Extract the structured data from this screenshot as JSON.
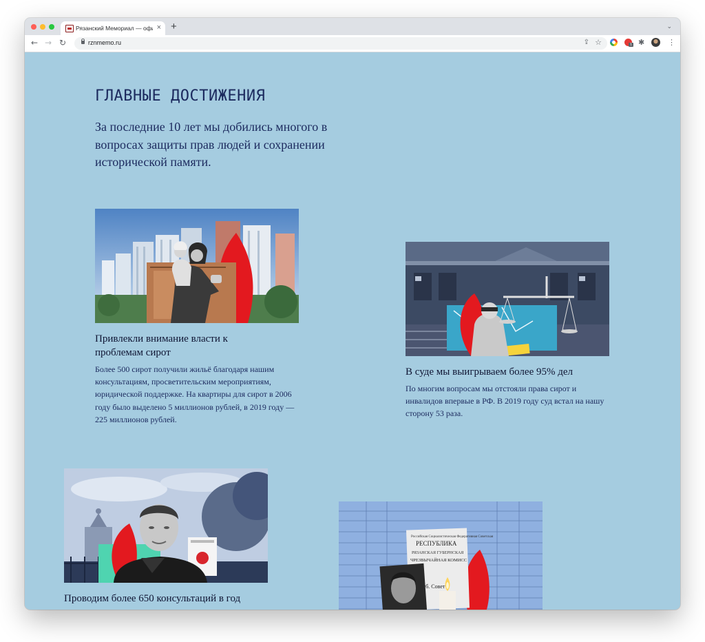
{
  "browser": {
    "tab_title": "Рязанский Мемориал — официальный сайт",
    "tab_close": "×",
    "new_tab": "+",
    "tab_menu": "⌄",
    "url": "rznmemo.ru",
    "ext_badge": "1"
  },
  "page": {
    "heading": "ГЛАВНЫЕ ДОСТИЖЕНИЯ",
    "lead": "За последние 10 лет мы добились многого в вопросах защиты прав людей и сохранении исторической памяти.",
    "achievements": [
      {
        "title": "Привлекли внимание власти к проблемам сирот",
        "text": "Более 500 сирот получили жильё благодаря нашим консультациям, просветительским мероприятиям, юридической поддержке. На квартиры для сирот в 2006 году было выделено 5 миллионов рублей, в 2019 году — 225 миллионов рублей."
      },
      {
        "title": "В суде мы выигрываем более 95% дел",
        "text": "По многим вопросам мы отстояли права сирот и инвалидов впервые в РФ. В 2019 году суд встал на нашу сторону 53 раза."
      },
      {
        "title": "Проводим более 650 консультаций в год"
      },
      {
        "image_text": [
          "Российская Социалистическая Федеративная Советская",
          "РЕСПУБЛИКА",
          "РЯЗАНСКАЯ ГУБЕРНСКАЯ",
          "ЧРЕЗВЫЧАЙНАЯ КОМИСС",
          "Губ. Совет"
        ]
      }
    ]
  },
  "colors": {
    "page_bg": "#a5cce0",
    "heading": "#1c2a5e",
    "accent_red": "#e3191f"
  }
}
